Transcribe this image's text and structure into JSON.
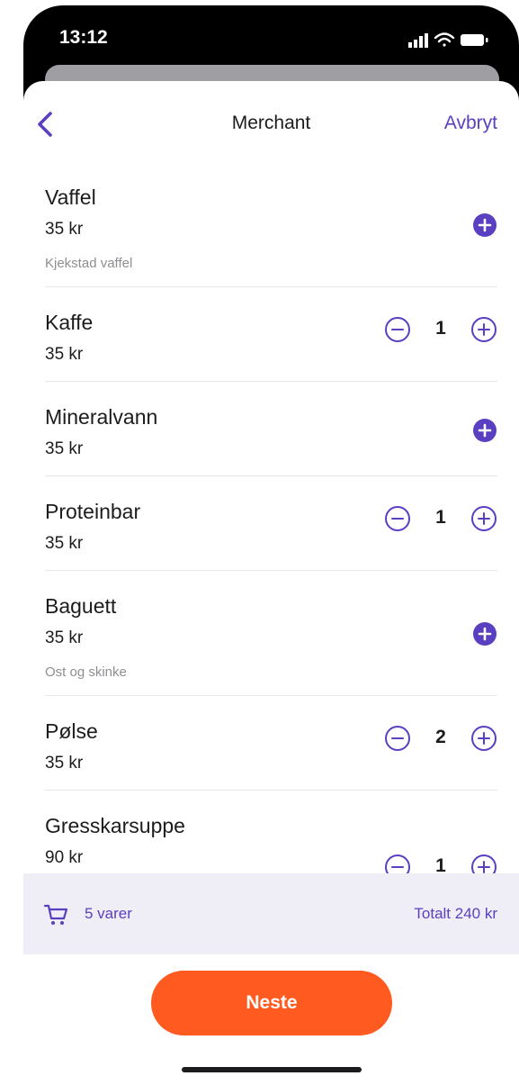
{
  "status_bar": {
    "time": "13:12"
  },
  "nav": {
    "title": "Merchant",
    "cancel_label": "Avbryt"
  },
  "items": [
    {
      "name": "Vaffel",
      "price": "35 kr",
      "description": "Kjekstad vaffel",
      "quantity": null
    },
    {
      "name": "Kaffe",
      "price": "35 kr",
      "description": null,
      "quantity": "1"
    },
    {
      "name": "Mineralvann",
      "price": "35 kr",
      "description": null,
      "quantity": null
    },
    {
      "name": "Proteinbar",
      "price": "35 kr",
      "description": null,
      "quantity": "1"
    },
    {
      "name": "Baguett",
      "price": "35 kr",
      "description": "Ost og skinke",
      "quantity": null
    },
    {
      "name": "Pølse",
      "price": "35 kr",
      "description": null,
      "quantity": "2"
    },
    {
      "name": "Gresskarsuppe",
      "price": "90 kr",
      "description": null,
      "quantity": "1"
    }
  ],
  "cart": {
    "count_label": "5 varer",
    "total_label": "Totalt 240 kr"
  },
  "actions": {
    "next_label": "Neste"
  },
  "colors": {
    "accent": "#5a3fc0",
    "primary_button": "#ff5a1f",
    "cart_bar_bg": "#efeef6"
  },
  "icons": [
    "chevron-left-icon",
    "plus-circle-filled-icon",
    "minus-circle-icon",
    "plus-circle-icon",
    "cart-icon",
    "signal-icon",
    "wifi-icon",
    "battery-icon"
  ]
}
